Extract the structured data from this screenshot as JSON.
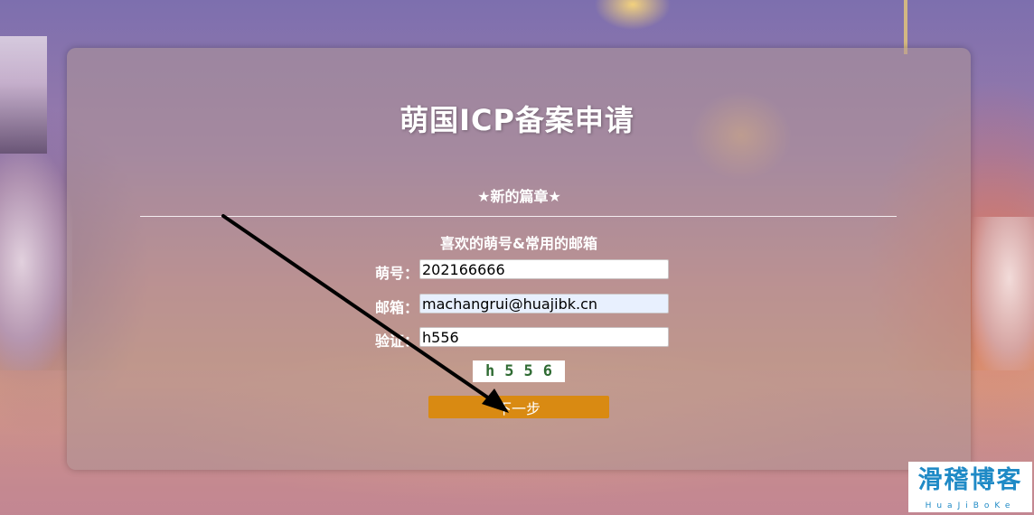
{
  "header": {
    "title": "萌国ICP备案申请",
    "subtitle": "★新的篇章★",
    "prompt": "喜欢的萌号&常用的邮箱"
  },
  "form": {
    "fields": [
      {
        "label": "萌号：",
        "value": "202166666"
      },
      {
        "label": "邮箱：",
        "value": "machangrui@huajibk.cn"
      },
      {
        "label": "验证：",
        "value": "h556"
      }
    ],
    "captcha": "h556",
    "next_label": "下一步"
  },
  "watermark": {
    "name": "滑稽博客",
    "sub": "HuaJiBoKe"
  },
  "colors": {
    "button": "#d98a12",
    "captcha_text": "#2f6b33",
    "logo": "#1f8ac6"
  }
}
